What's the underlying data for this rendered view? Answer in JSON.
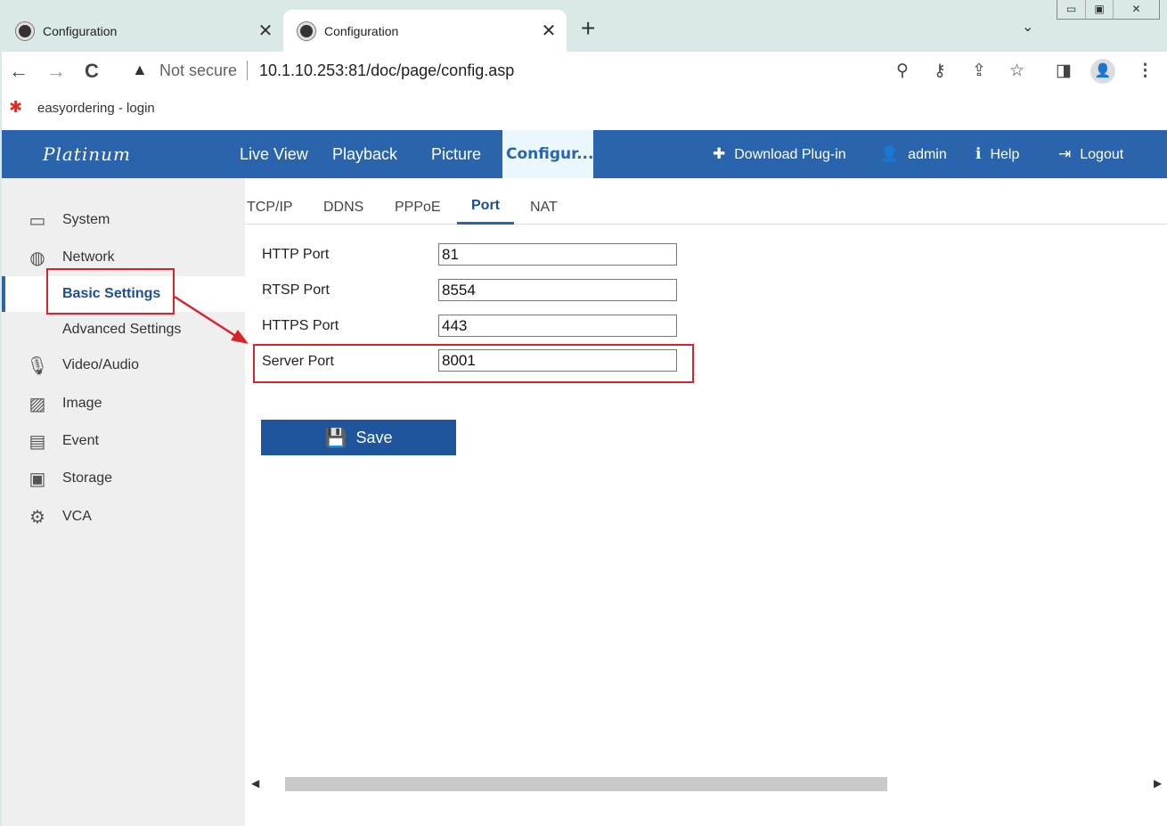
{
  "browser": {
    "tabs": [
      {
        "title": "Configuration",
        "close": "✕"
      },
      {
        "title": "Configuration",
        "close": "✕"
      }
    ],
    "new_tab": "+",
    "tab_list": "⌄",
    "window_controls": {
      "minimize": "▭",
      "maximize": "▣",
      "close": "✕"
    },
    "nav": {
      "back": "←",
      "forward": "→",
      "reload": "C"
    },
    "security_warning_icon": "▲",
    "security_text": "Not secure",
    "url": "10.1.10.253:81/doc/page/config.asp",
    "toolbar_icons": {
      "search": "⚲",
      "key": "⚷",
      "share": "⇪",
      "star": "☆",
      "sidepanel": "◨",
      "profile": "👤",
      "menu": "⋮"
    },
    "bookmark": {
      "icon": "✱",
      "label": "easyordering - login"
    }
  },
  "app": {
    "brand": "Platinum",
    "menu": [
      {
        "label": "Live View"
      },
      {
        "label": "Playback"
      },
      {
        "label": "Picture"
      },
      {
        "label": "Configur..."
      }
    ],
    "header_items": {
      "plugin": {
        "icon": "✚",
        "label": "Download Plug-in"
      },
      "user": {
        "icon": "👤",
        "label": "admin"
      },
      "help": {
        "icon": "ℹ",
        "label": "Help"
      },
      "logout": {
        "icon": "⇥",
        "label": "Logout"
      }
    }
  },
  "sidebar": {
    "items": [
      {
        "icon": "▭",
        "label": "System"
      },
      {
        "icon": "◍",
        "label": "Network"
      },
      {
        "icon": "🎙",
        "label": "Video/Audio"
      },
      {
        "icon": "▨",
        "label": "Image"
      },
      {
        "icon": "▤",
        "label": "Event"
      },
      {
        "icon": "▣",
        "label": "Storage"
      },
      {
        "icon": "⚙",
        "label": "VCA"
      }
    ],
    "network_sub": [
      {
        "label": "Basic Settings"
      },
      {
        "label": "Advanced Settings"
      }
    ]
  },
  "content": {
    "subtabs": [
      {
        "label": "TCP/IP"
      },
      {
        "label": "DDNS"
      },
      {
        "label": "PPPoE"
      },
      {
        "label": "Port"
      },
      {
        "label": "NAT"
      }
    ],
    "fields": [
      {
        "label": "HTTP Port",
        "value": "81"
      },
      {
        "label": "RTSP Port",
        "value": "8554"
      },
      {
        "label": "HTTPS Port",
        "value": "443"
      },
      {
        "label": "Server Port",
        "value": "8001"
      }
    ],
    "save": {
      "icon": "💾",
      "label": "Save"
    },
    "scroll": {
      "left": "◀",
      "right": "▶"
    }
  },
  "colors": {
    "header_blue": "#2a64ad",
    "save_blue": "#1f559c",
    "highlight_red": "#d6242a"
  }
}
